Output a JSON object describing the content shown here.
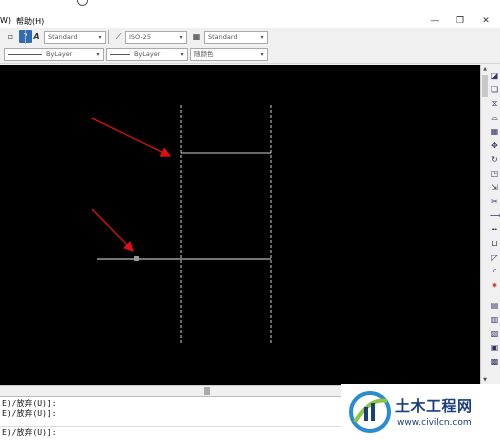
{
  "menubar": {
    "items": [
      {
        "label": "W)"
      },
      {
        "label": "帮助(H)"
      }
    ]
  },
  "toolbar1": {
    "text_style": "Standard",
    "dim_style": "ISO-25",
    "table_style": "Standard"
  },
  "toolbar2": {
    "linetype": "ByLayer",
    "lineweight": "ByLayer",
    "plot_color": "随颜色"
  },
  "command": {
    "lines": [
      "E)/放弃(U)]:",
      "E)/放弃(U)]:",
      "E)/放弃(U)]:"
    ]
  },
  "watermark": {
    "brand": "土木工程网",
    "url": "www.civilcn.com"
  },
  "colors": {
    "canvas": "#000000",
    "guide_line": "#d0d0d0",
    "arrow": "#e01010",
    "brand": "#1b3f7a"
  }
}
